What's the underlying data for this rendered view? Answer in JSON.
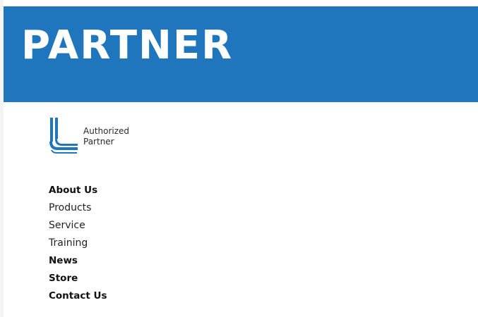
{
  "banner": {
    "title": "PARTNER",
    "color": "#1f76bd"
  },
  "logo": {
    "icon": "authorized-partner-logo-icon",
    "line1": "Authorized",
    "line2": "Partner"
  },
  "nav": {
    "items": [
      {
        "label": "About Us",
        "bold": true
      },
      {
        "label": "Products",
        "bold": false
      },
      {
        "label": "Service",
        "bold": false
      },
      {
        "label": "Training",
        "bold": false
      },
      {
        "label": "News",
        "bold": true
      },
      {
        "label": "Store",
        "bold": true
      },
      {
        "label": "Contact Us",
        "bold": true
      }
    ]
  }
}
